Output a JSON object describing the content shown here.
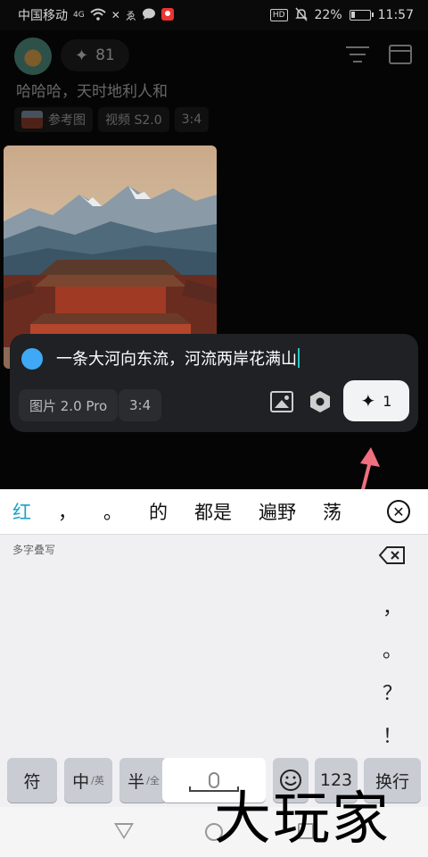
{
  "status_bar": {
    "carrier": "中国移动",
    "network": "4G",
    "battery": "22%",
    "time": "11:57",
    "hd": "HD"
  },
  "app": {
    "credits": "81",
    "history_prompt": "哈哈哈，天时地利人和",
    "meta": {
      "ref_label": "参考图",
      "model": "视频 S2.0",
      "ratio": "3:4"
    }
  },
  "composer": {
    "input_value": "一条大河向东流，河流两岸花满山",
    "model_chip": "图片 2.0 Pro",
    "ratio_chip": "3:4",
    "generate_count": "1",
    "dot_color": "#3fa9f5"
  },
  "keyboard": {
    "candidates": [
      "红",
      "，",
      "。",
      "的",
      "都是",
      "遍野",
      "荡"
    ],
    "handwriting_hint": "多字叠写",
    "side_keys": [
      "，",
      "。",
      "？",
      "！"
    ],
    "keys": {
      "symbol": "符",
      "zh": "中",
      "zh_sub": "/英",
      "half": "半",
      "half_sub": "/全",
      "num": "123",
      "enter": "换行"
    }
  },
  "watermark": "大玩家",
  "colors": {
    "accent_candidate": "#1aa3c9",
    "arrow": "#f07080"
  }
}
